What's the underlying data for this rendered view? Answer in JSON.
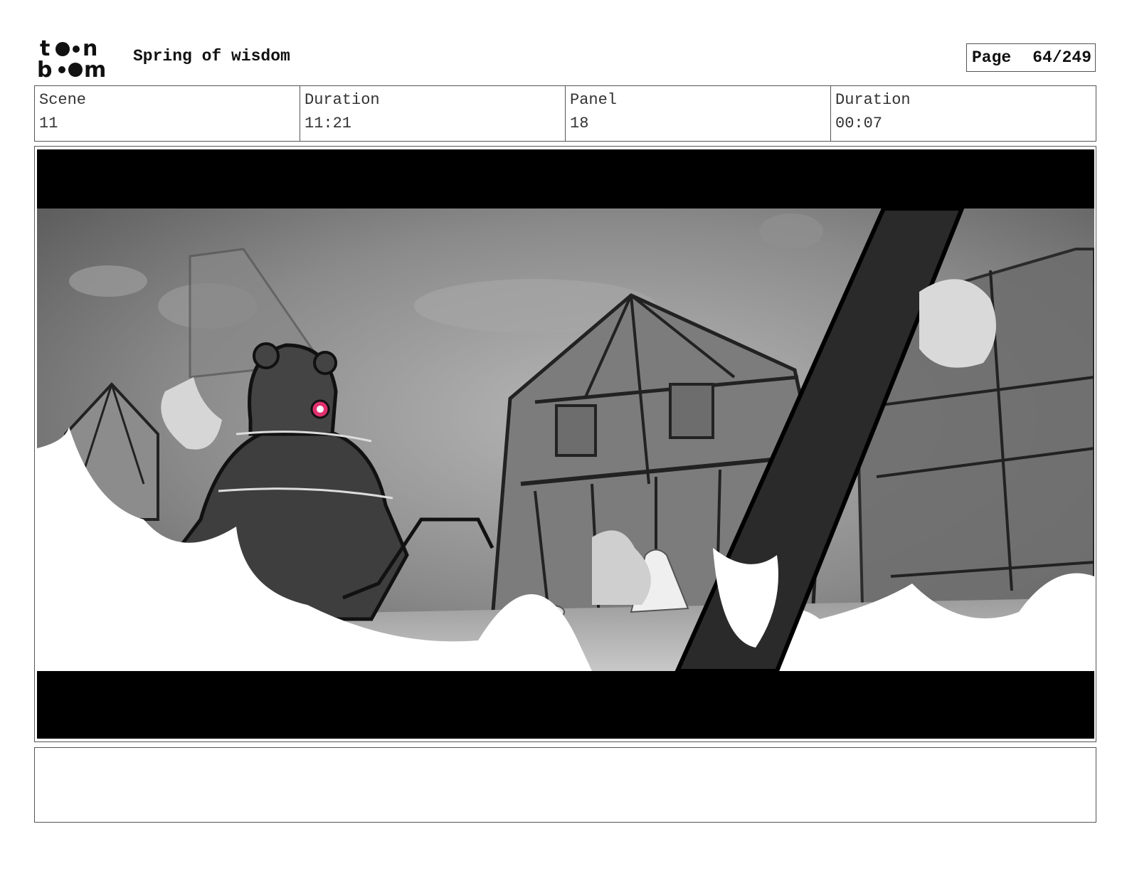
{
  "header": {
    "logo_alt": "toon boom",
    "title": "Spring of wisdom",
    "page_label": "Page",
    "page_value": "64/249"
  },
  "info": {
    "scene_label": "Scene",
    "scene_value": "11",
    "scene_duration_label": "Duration",
    "scene_duration_value": "11:21",
    "panel_label": "Panel",
    "panel_value": "18",
    "panel_duration_label": "Duration",
    "panel_duration_value": "00:07"
  },
  "panel": {
    "description": "",
    "accent_color": "#e0306e"
  },
  "notes": {
    "text": ""
  }
}
